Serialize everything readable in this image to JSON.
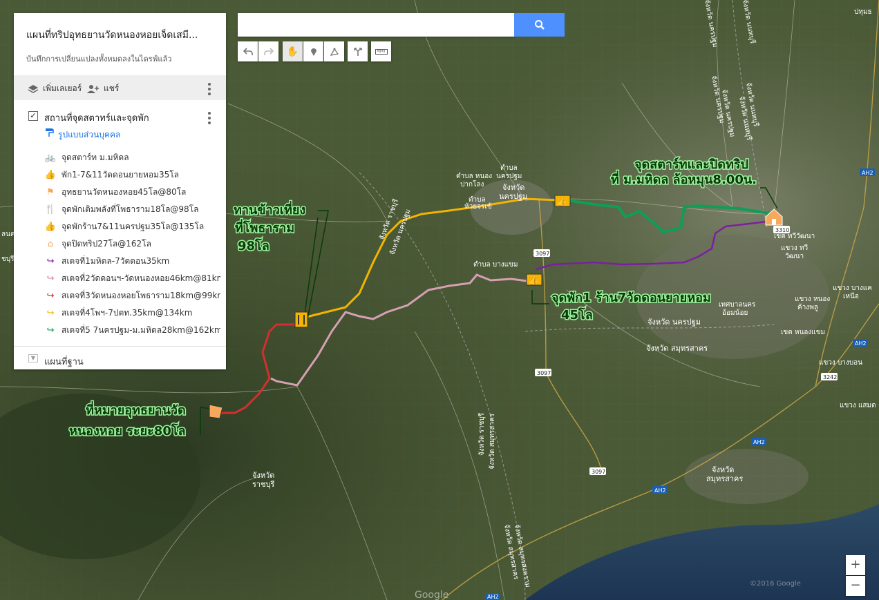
{
  "panel": {
    "title": "แผนที่ทริปอุทธยานวัดหนองหอยเจ็ดเสมี...",
    "subtitle": "บันทึกการเปลี่ยนแปลงทั้งหมดลงในไดรฟ์แล้ว",
    "add_layer": "เพิ่มเลเยอร์",
    "share": "แชร์",
    "layer_title": "สถานที่จุดสตาทร์และจุดพัก",
    "style_link": "รูปแบบส่วนบุคคล",
    "items": [
      {
        "label": "จุดสตาร์ท ม.มหิดล",
        "icon": "bicycle-icon",
        "color": "#f4b400"
      },
      {
        "label": "พัก1-7&11วัดดอนยายหอม35โล",
        "icon": "thumbs-up-icon",
        "color": "#f4b400"
      },
      {
        "label": "อุทธยานวัดหนองหอย45โล@80โล",
        "icon": "flag-icon",
        "color": "#f6a95c"
      },
      {
        "label": "จุดพักเติมพลังที่โพธาราม18โล@98โล",
        "icon": "restaurant-icon",
        "color": "#f4b400"
      },
      {
        "label": "จุดพักร้าน7&11นครปฐม35โล@135โล",
        "icon": "thumbs-up-icon",
        "color": "#f4b400"
      },
      {
        "label": "จุดปิดทริป27โล@162โล",
        "icon": "home-icon",
        "color": "#f6a95c"
      },
      {
        "label": "สเตจที่1มหิดล-7วัดดอน35km",
        "icon": "route-icon",
        "color": "#7b1fa2"
      },
      {
        "label": "สเตจที่2วัดดอนฯ-วัดหนองหอย46km@81km",
        "icon": "route-icon",
        "color": "#d6819c"
      },
      {
        "label": "สเตจที่3วัดหนองหอยโพธาราม18km@99km",
        "icon": "route-icon",
        "color": "#c62828"
      },
      {
        "label": "สเตจที่4โพฯ-7ปตท.35km@134km",
        "icon": "route-icon",
        "color": "#f4b400"
      },
      {
        "label": "สเตจที่5 7นครปฐม-ม.มหิดล28km@162km",
        "icon": "route-icon",
        "color": "#0f9d58"
      }
    ],
    "basemap": "แผนที่ฐาน"
  },
  "search": {
    "value": "",
    "placeholder": ""
  },
  "zoom": {
    "in": "+",
    "out": "−"
  },
  "map_labels": [
    "จังหวัด นครปฐม",
    "จังหวัด ราชบุรี",
    "จังหวัด สมุทรสาคร",
    "จังหวัด นนทบุรี",
    "จังหวัด\nนครปฐม",
    "จังหวัด\nราชบุรี",
    "จังหวัด\nสมุทรสาคร",
    "ตำบล\nนครปฐม",
    "ตำบล\nห้วยจรเข้",
    "ตำบล บางแขม",
    "ตำบล หนอง\nปากโลง",
    "เขต ทวีวัฒนา",
    "แขวง ทวี\nวัฒนา",
    "เทศบาลนคร\nอ้อมน้อย",
    "แขวง บางแค\nเหนือ",
    "แขวง หนอง\nค้างพลู",
    "เขต หนองแขม",
    "แขวง บางบอน",
    "ปทุมธ",
    "แขวง แสมด"
  ],
  "road_shields": [
    "3097",
    "3097",
    "3097",
    "3310",
    "3242",
    "AH2",
    "AH2",
    "AH2",
    "AH2",
    "AH2"
  ],
  "annotations": [
    "จุดสตาร์ทและปิดทริป",
    "ที่ ม.มหิดล ล้อหมุน8.00น.",
    "ทานข้าวเที่ยง",
    "ที่โพธาราม",
    "98โล",
    "จุดพัก1 ร้าน7วัดดอนยายหอม",
    "45โล",
    "ที่หมายอุทธยานวัด",
    "หนองหอย ระยะ80โล"
  ],
  "attribution": "Google",
  "copyright": "©2016 Google"
}
